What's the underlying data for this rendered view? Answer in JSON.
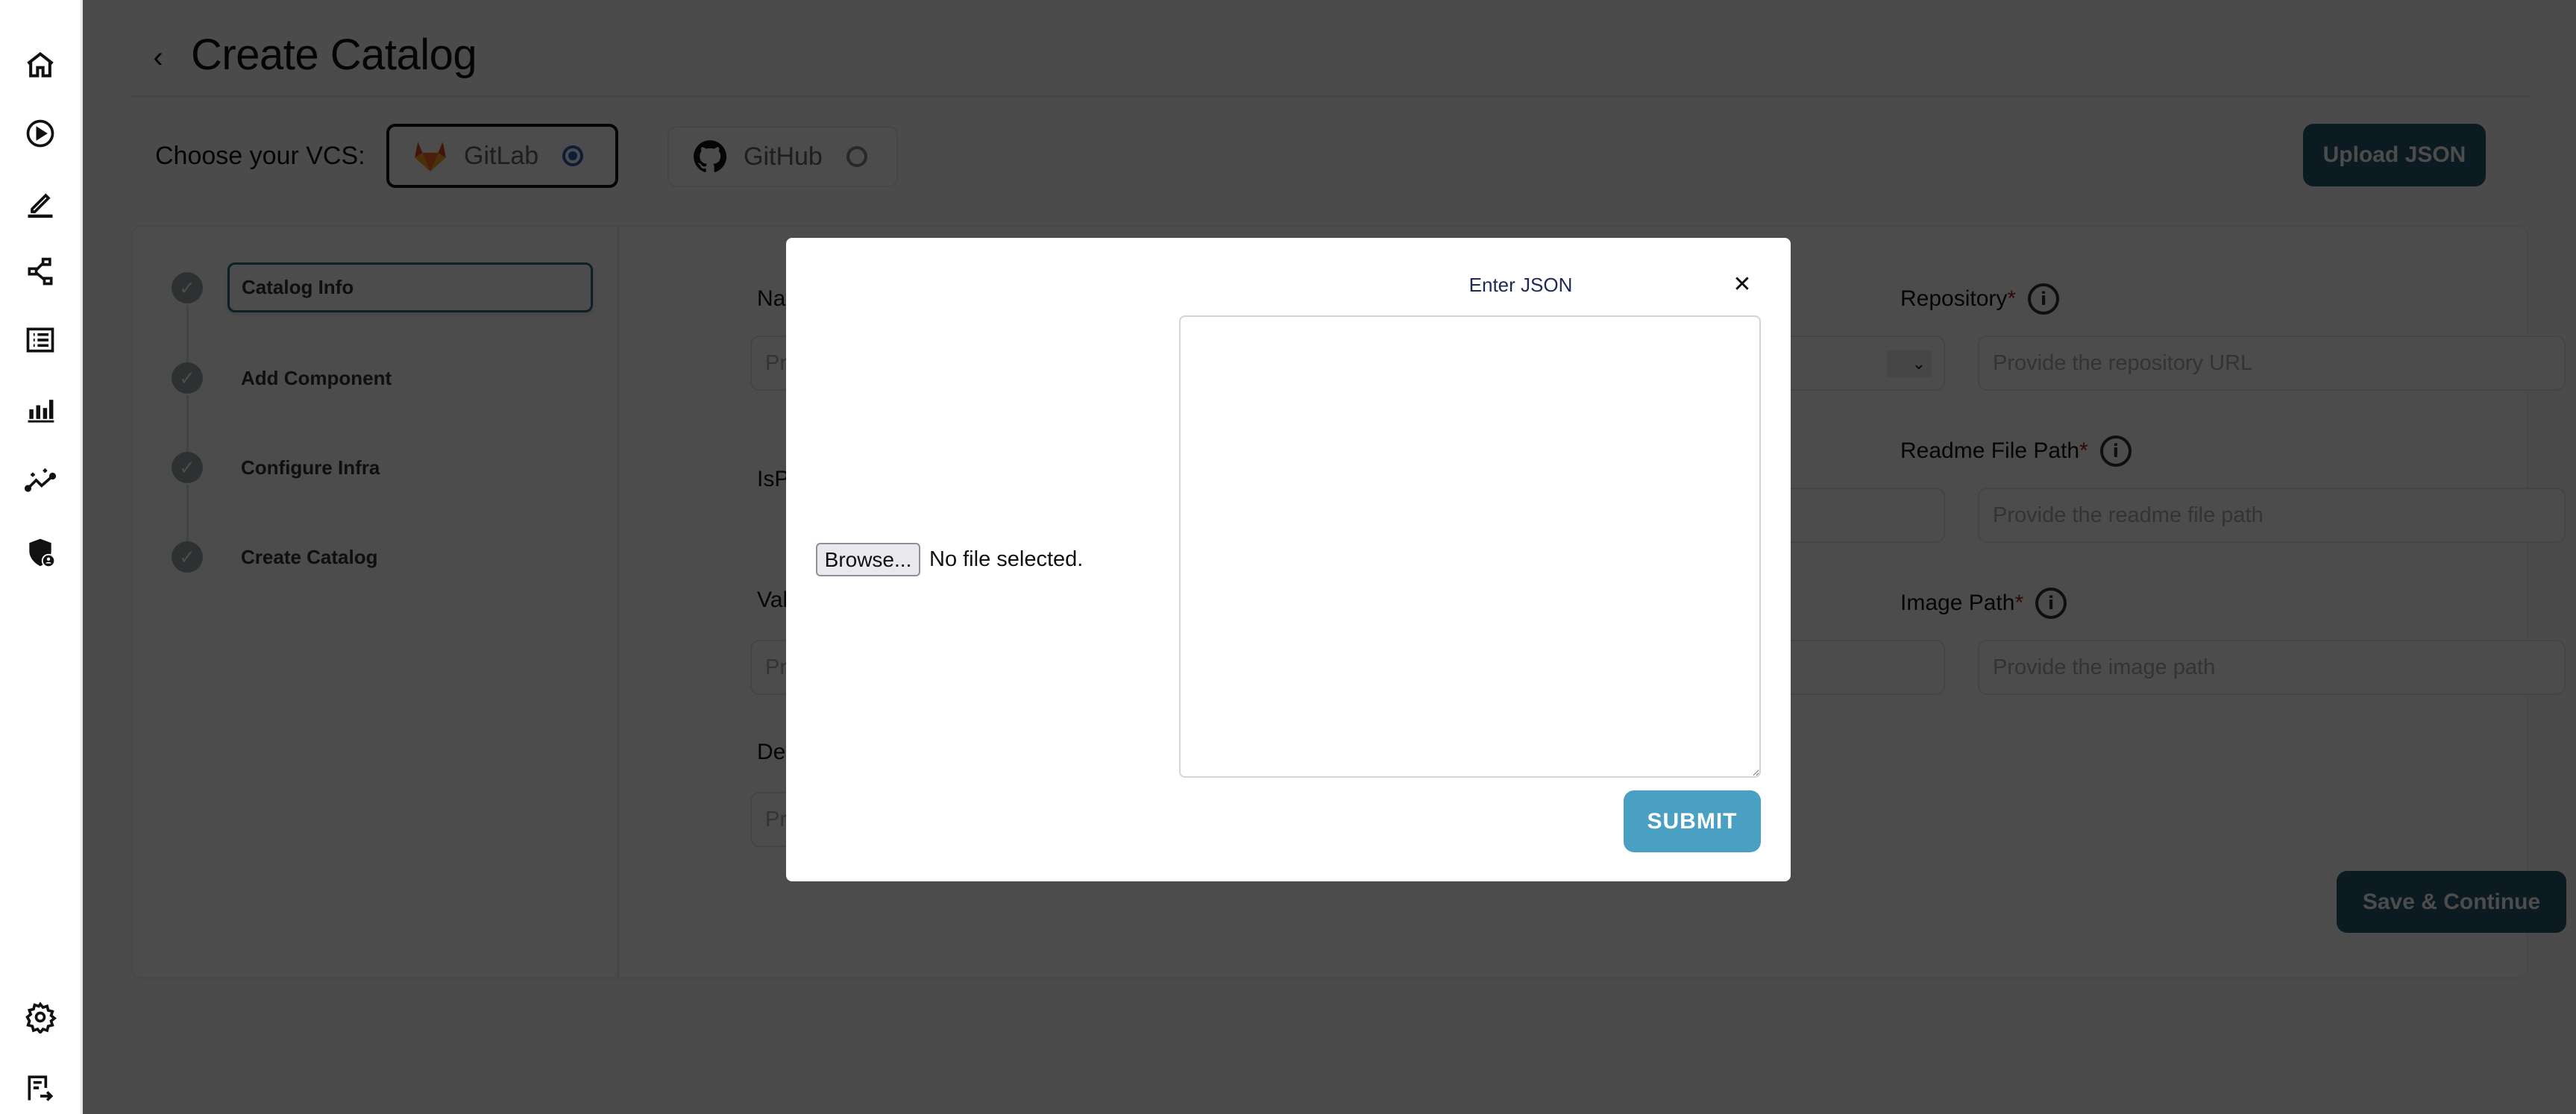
{
  "sidebar": {
    "items": [
      {
        "icon": "home-icon"
      },
      {
        "icon": "play-circle-icon"
      },
      {
        "icon": "edit-pencil-icon"
      },
      {
        "icon": "workflow-nodes-icon"
      },
      {
        "icon": "list-icon"
      },
      {
        "icon": "bar-chart-icon"
      },
      {
        "icon": "trend-sparkle-icon"
      },
      {
        "icon": "shield-user-icon"
      }
    ],
    "bottom_items": [
      {
        "icon": "settings-gear-icon"
      },
      {
        "icon": "message-export-icon"
      }
    ]
  },
  "header": {
    "back_icon": "chevron-left-icon",
    "title": "Create Catalog"
  },
  "vcs": {
    "label": "Choose your VCS:",
    "options": [
      {
        "label": "GitLab",
        "selected": true
      },
      {
        "label": "GitHub",
        "selected": false
      }
    ],
    "selected_color": "#2f5fc4"
  },
  "upload_button": "Upload JSON",
  "steps": [
    {
      "label": "Catalog Info",
      "active": true
    },
    {
      "label": "Add Component",
      "active": false
    },
    {
      "label": "Configure Infra",
      "active": false
    },
    {
      "label": "Create Catalog",
      "active": false
    }
  ],
  "form": {
    "name": {
      "label": "Name",
      "required": "*",
      "placeholder": "Provide the"
    },
    "is_private": {
      "label": "IsPrivate"
    },
    "values_folder": {
      "label": "Values Fold",
      "placeholder": "Provide the"
    },
    "description": {
      "label": "Description",
      "placeholder": "Provide the"
    },
    "repository": {
      "label": "Repository",
      "required": "*",
      "placeholder": "Provide the repository URL"
    },
    "readme": {
      "label": "Readme File Path",
      "required": "*",
      "placeholder": "Provide the readme file path"
    },
    "image_path": {
      "label": "Image Path",
      "required": "*",
      "placeholder": "Provide the image path"
    },
    "info_glyph": "i",
    "select_chevron": "⌄"
  },
  "save_button": "Save & Continue",
  "modal": {
    "title": "Enter JSON",
    "close": "✕",
    "browse_label": "Browse...",
    "file_status": "No file selected.",
    "textarea_value": "",
    "submit_label": "SUBMIT"
  },
  "colors": {
    "primary": "#2a5d6e",
    "submit": "#49a0c2",
    "required": "#b02020"
  }
}
